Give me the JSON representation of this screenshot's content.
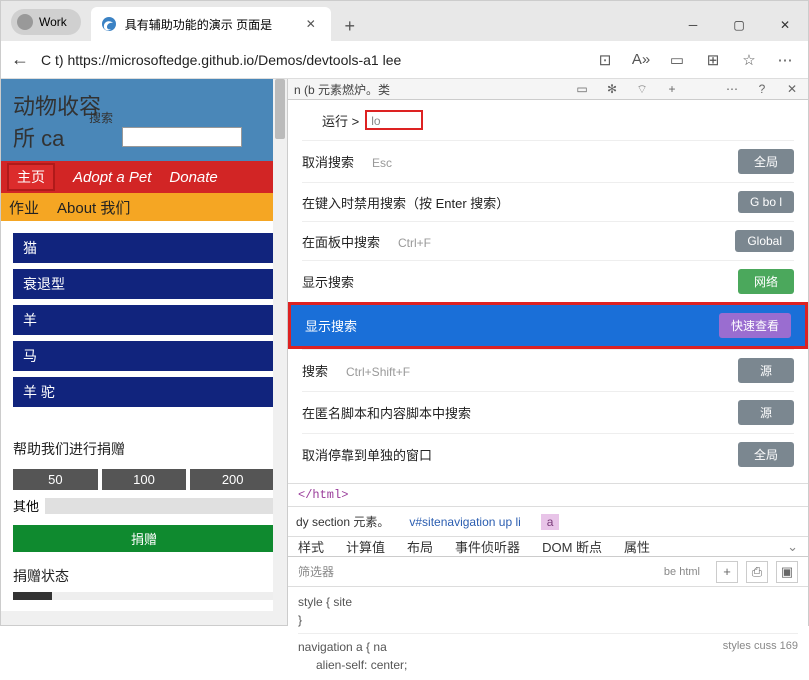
{
  "window": {
    "persona": "Work",
    "tab_title": "具有辅助功能的演示 页面是",
    "url": "C t) https://microsoftedge.github.io/Demos/devtools-a1 lee"
  },
  "page": {
    "title_line1": "动物收容",
    "title_line2": "所 ca",
    "search_label": "搜索",
    "nav_home": "主页",
    "nav_adopt": "Adopt a Pet",
    "nav_donate": "Donate",
    "nav_jobs": "作业",
    "nav_about": "About 我们",
    "animals": [
      "猫",
      "衰退型",
      "羊",
      "马",
      "羊 驼"
    ],
    "donate_title": "帮助我们进行捐赠",
    "amounts": [
      "50",
      "100",
      "200"
    ],
    "other_label": "其他",
    "donate_btn": "捐赠",
    "status_title": "捐赠状态"
  },
  "devtools": {
    "top_text": "n (b 元素燃炉。类",
    "run_label": "运行 >",
    "run_value": "lo",
    "commands": [
      {
        "text": "取消搜索",
        "hint": "Esc",
        "badge": "全局",
        "badge_cls": "bg-gray"
      },
      {
        "text": "在键入时禁用搜索（按 Enter 搜索）",
        "hint": "",
        "badge": "G bo  l",
        "badge_cls": "bg-gray"
      },
      {
        "text": "在面板中搜索",
        "hint": "Ctrl+F",
        "badge": "Global",
        "badge_cls": "bg-gray"
      },
      {
        "text": "显示搜索",
        "hint": "",
        "badge": "网络",
        "badge_cls": "bg-green"
      },
      {
        "text": "显示搜索",
        "hint": "",
        "badge": "快速查看",
        "badge_cls": "bg-purple",
        "selected": true
      },
      {
        "text": "搜索",
        "hint": "Ctrl+Shift+F",
        "badge": "源",
        "badge_cls": "bg-gray"
      },
      {
        "text": "在匿名脚本和内容脚本中搜索",
        "hint": "",
        "badge": "源",
        "badge_cls": "bg-gray"
      },
      {
        "text": "取消停靠到单独的窗口",
        "hint": "",
        "badge": "全局",
        "badge_cls": "bg-gray"
      }
    ],
    "html_close": "</html>",
    "crumb1": "dy section 元素。",
    "crumb2": "v#sitenavigation up li",
    "crumb3": "a",
    "tabs": [
      "样式",
      "计算值",
      "布局",
      "事件侦听器",
      "DOM 断点",
      "属性"
    ],
    "filter_label": "筛选器",
    "be_html": "be html",
    "style_line1": "style { site",
    "style_line2": "}",
    "nav_a_line": "navigation a { na",
    "nav_a_right": "styles cuss 169",
    "alien": "alien-self:  center;"
  }
}
